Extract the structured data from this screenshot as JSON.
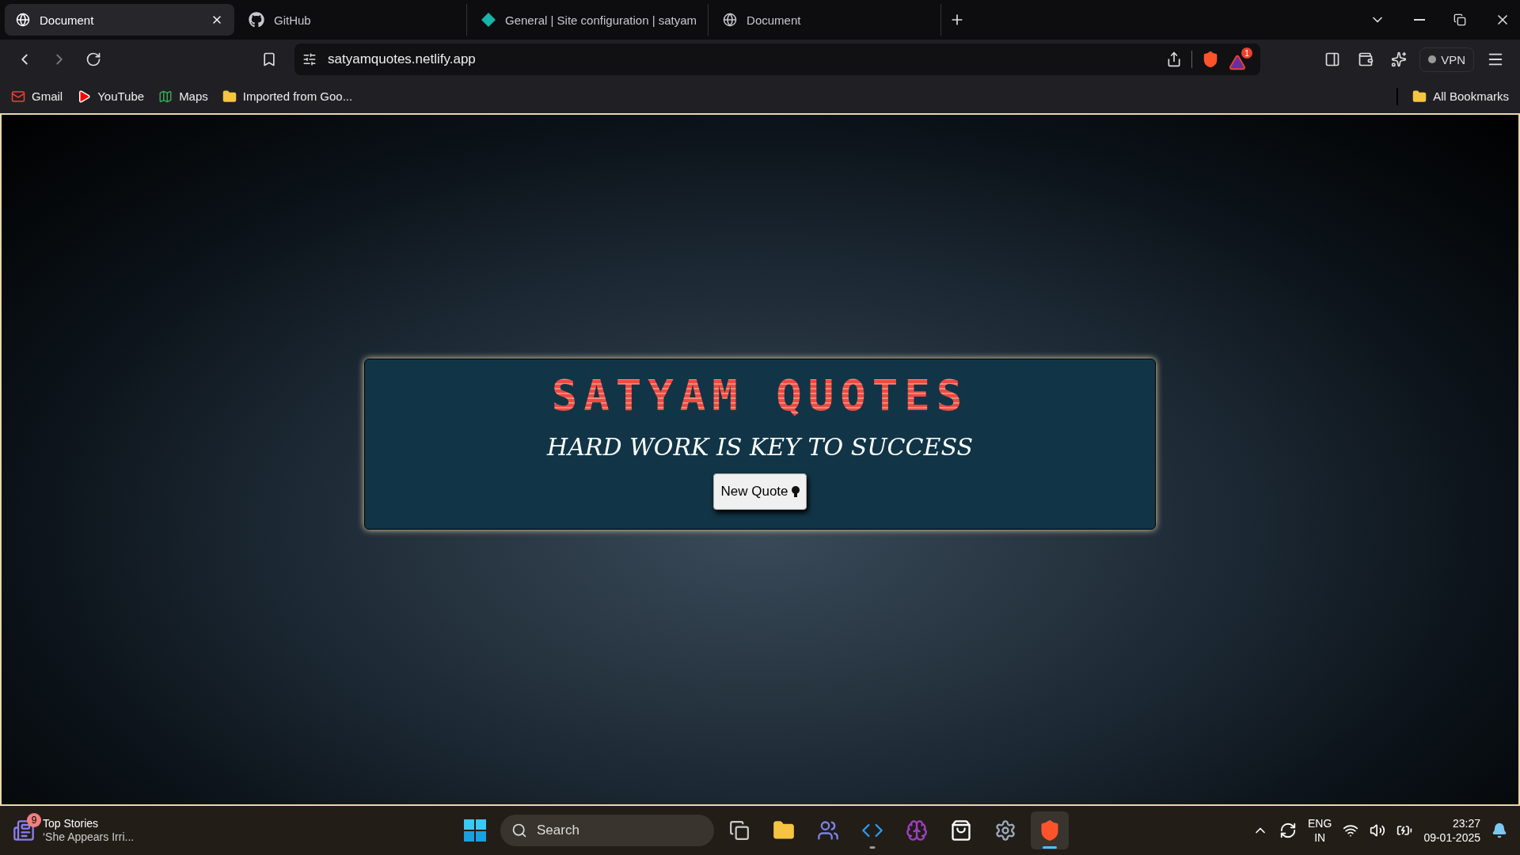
{
  "tabs": [
    {
      "title": "Document",
      "selected": true
    },
    {
      "title": "GitHub",
      "selected": false
    },
    {
      "title": "General | Site configuration | satyam",
      "selected": false
    },
    {
      "title": "Document",
      "selected": false
    }
  ],
  "address_bar": {
    "url": "satyamquotes.netlify.app",
    "rewards_badge": "1"
  },
  "vpn_button": "VPN",
  "bookmarks": [
    {
      "label": "Gmail"
    },
    {
      "label": "YouTube"
    },
    {
      "label": "Maps"
    },
    {
      "label": "Imported from Goo..."
    }
  ],
  "all_bookmarks": "All Bookmarks",
  "page": {
    "title": "SATYAM QUOTES",
    "quote": "HARD WORK IS KEY TO SUCCESS",
    "button": "New Quote"
  },
  "taskbar": {
    "news": {
      "count": "9",
      "title": "Top Stories",
      "subtitle": "‘She Appears Irri..."
    },
    "search_placeholder": "Search",
    "apps": [
      {
        "selected": false,
        "running": false
      },
      {
        "selected": false,
        "running": false
      },
      {
        "selected": false,
        "running": false
      },
      {
        "selected": false,
        "running": true
      },
      {
        "selected": false,
        "running": false
      },
      {
        "selected": false,
        "running": false
      },
      {
        "selected": false,
        "running": false
      },
      {
        "selected": true,
        "running": true
      }
    ],
    "language": "ENG",
    "region": "IN",
    "time": "23:27",
    "date": "09-01-2025"
  }
}
